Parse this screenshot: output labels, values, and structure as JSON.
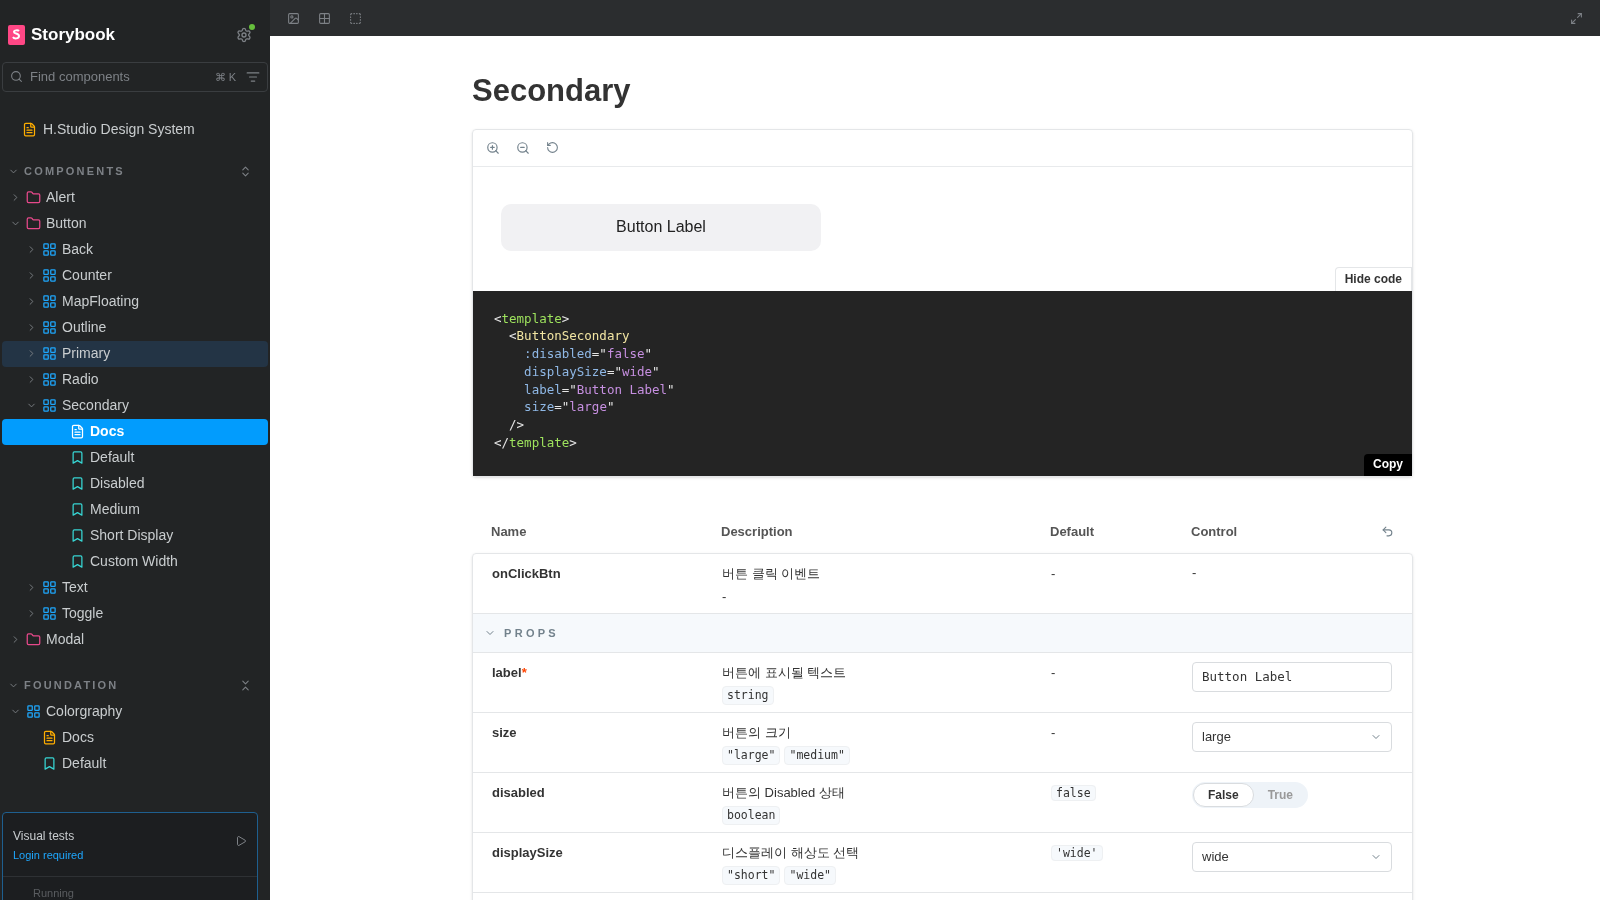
{
  "sidebar": {
    "brand": "Storybook",
    "search": {
      "placeholder": "Find components",
      "shortcut": "⌘ K"
    },
    "top_item": {
      "label": "H.Studio Design System",
      "kind": "docs"
    },
    "sections": [
      {
        "title": "COMPONENTS",
        "expanded": true,
        "items": [
          {
            "label": "Alert",
            "kind": "folder",
            "expanded": false,
            "selected": false,
            "hovered": false
          },
          {
            "label": "Button",
            "kind": "folder",
            "expanded": true,
            "selected": false,
            "hovered": false,
            "children": [
              {
                "label": "Back",
                "kind": "component",
                "expanded": false,
                "selected": false,
                "hovered": false
              },
              {
                "label": "Counter",
                "kind": "component",
                "expanded": false,
                "selected": false,
                "hovered": false
              },
              {
                "label": "MapFloating",
                "kind": "component",
                "expanded": false,
                "selected": false,
                "hovered": false
              },
              {
                "label": "Outline",
                "kind": "component",
                "expanded": false,
                "selected": false,
                "hovered": false
              },
              {
                "label": "Primary",
                "kind": "component",
                "expanded": false,
                "selected": false,
                "hovered": true
              },
              {
                "label": "Radio",
                "kind": "component",
                "expanded": false,
                "selected": false,
                "hovered": false
              },
              {
                "label": "Secondary",
                "kind": "component",
                "expanded": true,
                "selected": false,
                "hovered": false,
                "children": [
                  {
                    "label": "Docs",
                    "kind": "docs",
                    "selected": true,
                    "hovered": false
                  },
                  {
                    "label": "Default",
                    "kind": "story",
                    "selected": false,
                    "hovered": false
                  },
                  {
                    "label": "Disabled",
                    "kind": "story",
                    "selected": false,
                    "hovered": false
                  },
                  {
                    "label": "Medium",
                    "kind": "story",
                    "selected": false,
                    "hovered": false
                  },
                  {
                    "label": "Short Display",
                    "kind": "story",
                    "selected": false,
                    "hovered": false
                  },
                  {
                    "label": "Custom Width",
                    "kind": "story",
                    "selected": false,
                    "hovered": false
                  }
                ]
              },
              {
                "label": "Text",
                "kind": "component",
                "expanded": false,
                "selected": false,
                "hovered": false
              },
              {
                "label": "Toggle",
                "kind": "component",
                "expanded": false,
                "selected": false,
                "hovered": false
              }
            ]
          },
          {
            "label": "Modal",
            "kind": "folder",
            "expanded": false,
            "selected": false,
            "hovered": false
          }
        ]
      },
      {
        "title": "FOUNDATION",
        "expanded": true,
        "items": [
          {
            "label": "Colorgraphy",
            "kind": "component",
            "expanded": true,
            "selected": false,
            "hovered": false,
            "children": [
              {
                "label": "Docs",
                "kind": "docs",
                "selected": false,
                "hovered": false
              },
              {
                "label": "Default",
                "kind": "story",
                "selected": false,
                "hovered": false
              }
            ]
          }
        ]
      }
    ],
    "visual_tests": {
      "title": "Visual tests",
      "link": "Login required",
      "status": "Running"
    }
  },
  "page": {
    "title": "Secondary",
    "preview": {
      "button_label": "Button Label",
      "hide_code": "Hide code",
      "copy": "Copy",
      "code": [
        [
          {
            "kind": "punct",
            "text": "<"
          },
          {
            "kind": "tag",
            "text": "template"
          },
          {
            "kind": "punct",
            "text": ">"
          }
        ],
        [
          {
            "kind": "punct",
            "text": "  <"
          },
          {
            "kind": "component",
            "text": "ButtonSecondary"
          }
        ],
        [
          {
            "kind": "attr",
            "text": "    :disabled"
          },
          {
            "kind": "punct",
            "text": "=\""
          },
          {
            "kind": "string",
            "text": "false"
          },
          {
            "kind": "punct",
            "text": "\""
          }
        ],
        [
          {
            "kind": "attr",
            "text": "    displaySize"
          },
          {
            "kind": "punct",
            "text": "=\""
          },
          {
            "kind": "string",
            "text": "wide"
          },
          {
            "kind": "punct",
            "text": "\""
          }
        ],
        [
          {
            "kind": "attr",
            "text": "    label"
          },
          {
            "kind": "punct",
            "text": "=\""
          },
          {
            "kind": "string",
            "text": "Button Label"
          },
          {
            "kind": "punct",
            "text": "\""
          }
        ],
        [
          {
            "kind": "attr",
            "text": "    size"
          },
          {
            "kind": "punct",
            "text": "=\""
          },
          {
            "kind": "string",
            "text": "large"
          },
          {
            "kind": "punct",
            "text": "\""
          }
        ],
        [
          {
            "kind": "punct",
            "text": "  />"
          }
        ],
        [
          {
            "kind": "punct",
            "text": "</"
          },
          {
            "kind": "tag",
            "text": "template"
          },
          {
            "kind": "punct",
            "text": ">"
          }
        ]
      ]
    },
    "table": {
      "required_mark": "*",
      "columns": [
        "Name",
        "Description",
        "Default",
        "Control"
      ],
      "rows": [
        {
          "kind": "prop",
          "name": "onClickBtn",
          "required": false,
          "description": "버튼 클릭 이벤트",
          "types": [],
          "type_text": "-",
          "default": "-",
          "default_code": false,
          "control": {
            "kind": "text",
            "value": "-"
          }
        },
        {
          "kind": "group",
          "label": "PROPS",
          "expanded": true
        },
        {
          "kind": "prop",
          "name": "label",
          "required": true,
          "description": "버튼에 표시될 텍스트",
          "types": [
            "string"
          ],
          "default": "-",
          "default_code": false,
          "control": {
            "kind": "textarea",
            "value": "Button Label"
          }
        },
        {
          "kind": "prop",
          "name": "size",
          "required": false,
          "description": "버튼의 크기",
          "types": [
            "\"large\"",
            "\"medium\""
          ],
          "default": "-",
          "default_code": false,
          "control": {
            "kind": "select",
            "value": "large"
          }
        },
        {
          "kind": "prop",
          "name": "disabled",
          "required": false,
          "description": "버튼의 Disabled 상태",
          "types": [
            "boolean"
          ],
          "default": "false",
          "default_code": true,
          "control": {
            "kind": "toggle",
            "options": [
              {
                "label": "False",
                "selected": true
              },
              {
                "label": "True",
                "selected": false
              }
            ]
          }
        },
        {
          "kind": "prop",
          "name": "displaySize",
          "required": false,
          "description": "디스플레이 해상도 선택",
          "types": [
            "\"short\"",
            "\"wide\""
          ],
          "default": "'wide'",
          "default_code": true,
          "control": {
            "kind": "select",
            "value": "wide"
          }
        }
      ]
    }
  }
}
